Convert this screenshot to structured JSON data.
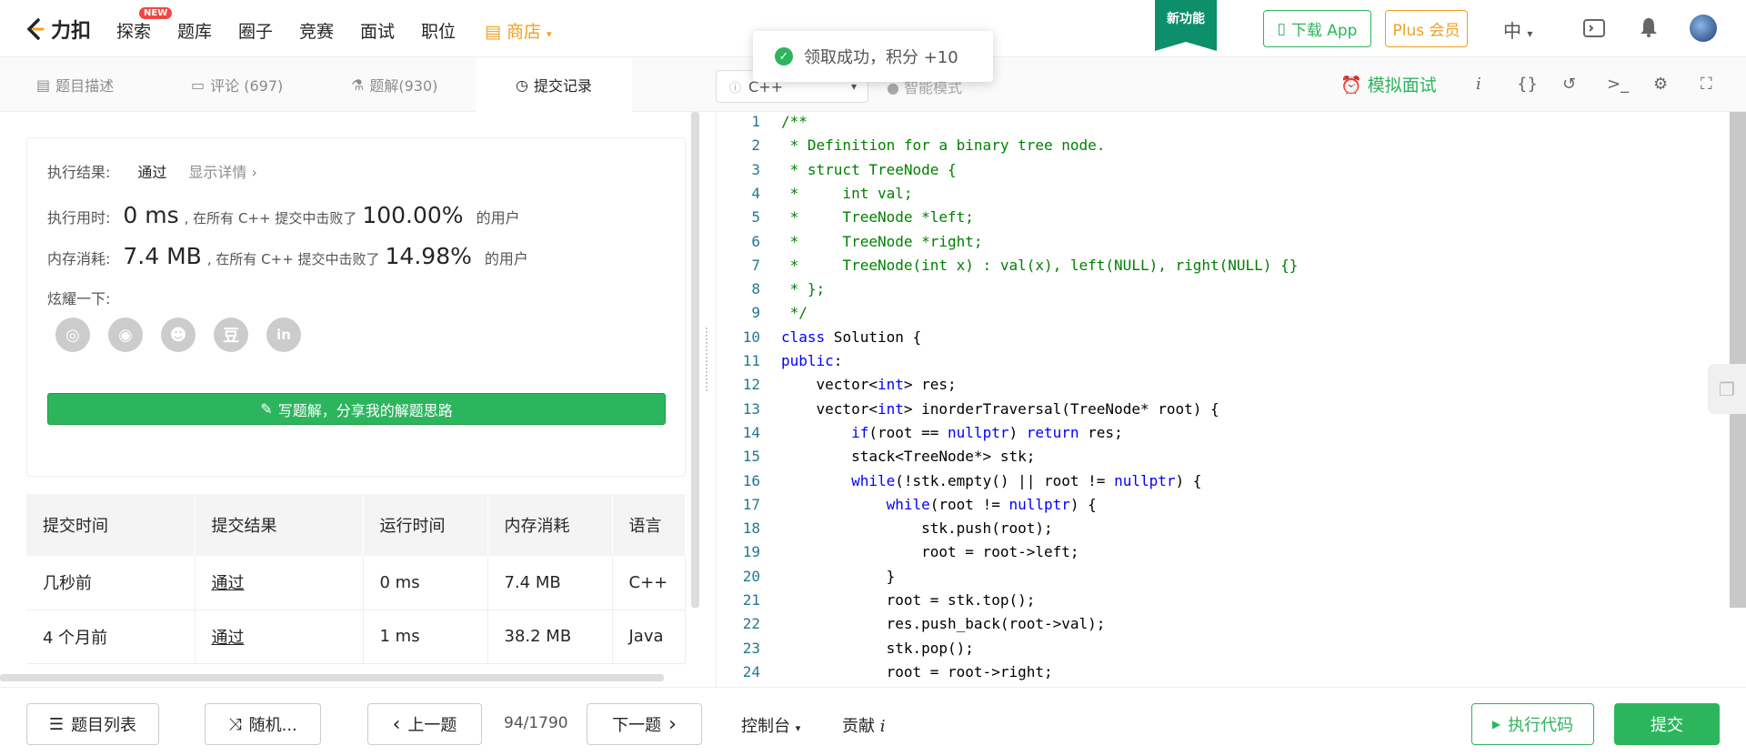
{
  "header": {
    "logo_text": "力扣",
    "nav": [
      "探索",
      "题库",
      "圈子",
      "竞赛",
      "面试",
      "职位"
    ],
    "new_badge": "NEW",
    "shop": "商店",
    "feature_flag": "新功能",
    "download_app": "下载 App",
    "plus": "Plus 会员",
    "lang": "中"
  },
  "toast": {
    "text": "领取成功，积分 +10"
  },
  "tabs": [
    {
      "label": "题目描述"
    },
    {
      "label": "评论 (697)"
    },
    {
      "label": "题解(930)"
    },
    {
      "label": "提交记录"
    }
  ],
  "editor_toolbar": {
    "language": "C++",
    "smart_mode": "智能模式",
    "mock_interview": "模拟面试"
  },
  "result": {
    "status_label": "执行结果:",
    "status": "通过",
    "detail_link": "显示详情",
    "time_label": "执行用时:",
    "time_value": "0 ms",
    "time_mid": ", 在所有 C++ 提交中击败了",
    "time_pct": "100.00%",
    "time_tail": "的用户",
    "mem_label": "内存消耗:",
    "mem_value": "7.4 MB",
    "mem_mid": ", 在所有 C++ 提交中击败了",
    "mem_pct": "14.98%",
    "mem_tail": "的用户",
    "share_label": "炫耀一下:",
    "write_solution": "写题解，分享我的解题思路"
  },
  "submissions": {
    "headers": [
      "提交时间",
      "提交结果",
      "运行时间",
      "内存消耗",
      "语言"
    ],
    "rows": [
      [
        "几秒前",
        "通过",
        "0 ms",
        "7.4 MB",
        "C++"
      ],
      [
        "4 个月前",
        "通过",
        "1 ms",
        "38.2 MB",
        "Java"
      ]
    ]
  },
  "code": [
    {
      "n": "1",
      "t": "/**"
    },
    {
      "n": "2",
      "t": " * Definition for a binary tree node."
    },
    {
      "n": "3",
      "t": " * struct TreeNode {"
    },
    {
      "n": "4",
      "t": " *     int val;"
    },
    {
      "n": "5",
      "t": " *     TreeNode *left;"
    },
    {
      "n": "6",
      "t": " *     TreeNode *right;"
    },
    {
      "n": "7",
      "t": " *     TreeNode(int x) : val(x), left(NULL), right(NULL) {}"
    },
    {
      "n": "8",
      "t": " * };"
    },
    {
      "n": "9",
      "t": " */"
    },
    {
      "n": "10",
      "t": "class Solution {"
    },
    {
      "n": "11",
      "t": "public:"
    },
    {
      "n": "12",
      "t": "    vector<int> res;"
    },
    {
      "n": "13",
      "t": "    vector<int> inorderTraversal(TreeNode* root) {"
    },
    {
      "n": "14",
      "t": "        if(root == nullptr) return res;"
    },
    {
      "n": "15",
      "t": "        stack<TreeNode*> stk;"
    },
    {
      "n": "16",
      "t": "        while(!stk.empty() || root != nullptr) {"
    },
    {
      "n": "17",
      "t": "            while(root != nullptr) {"
    },
    {
      "n": "18",
      "t": "                stk.push(root);"
    },
    {
      "n": "19",
      "t": "                root = root->left;"
    },
    {
      "n": "20",
      "t": "            }"
    },
    {
      "n": "21",
      "t": "            root = stk.top();"
    },
    {
      "n": "22",
      "t": "            res.push_back(root->val);"
    },
    {
      "n": "23",
      "t": "            stk.pop();"
    },
    {
      "n": "24",
      "t": "            root = root->right;"
    }
  ],
  "bottom": {
    "problem_list": "题目列表",
    "random": "随机...",
    "prev": "上一题",
    "counter": "94/1790",
    "next": "下一题",
    "console": "控制台",
    "contribute": "贡献",
    "run": "执行代码",
    "submit": "提交"
  },
  "colors": {
    "accent_green": "#2db55d",
    "comment_green": "#008000",
    "keyword_blue": "#0000ff",
    "line_num": "#237893"
  }
}
